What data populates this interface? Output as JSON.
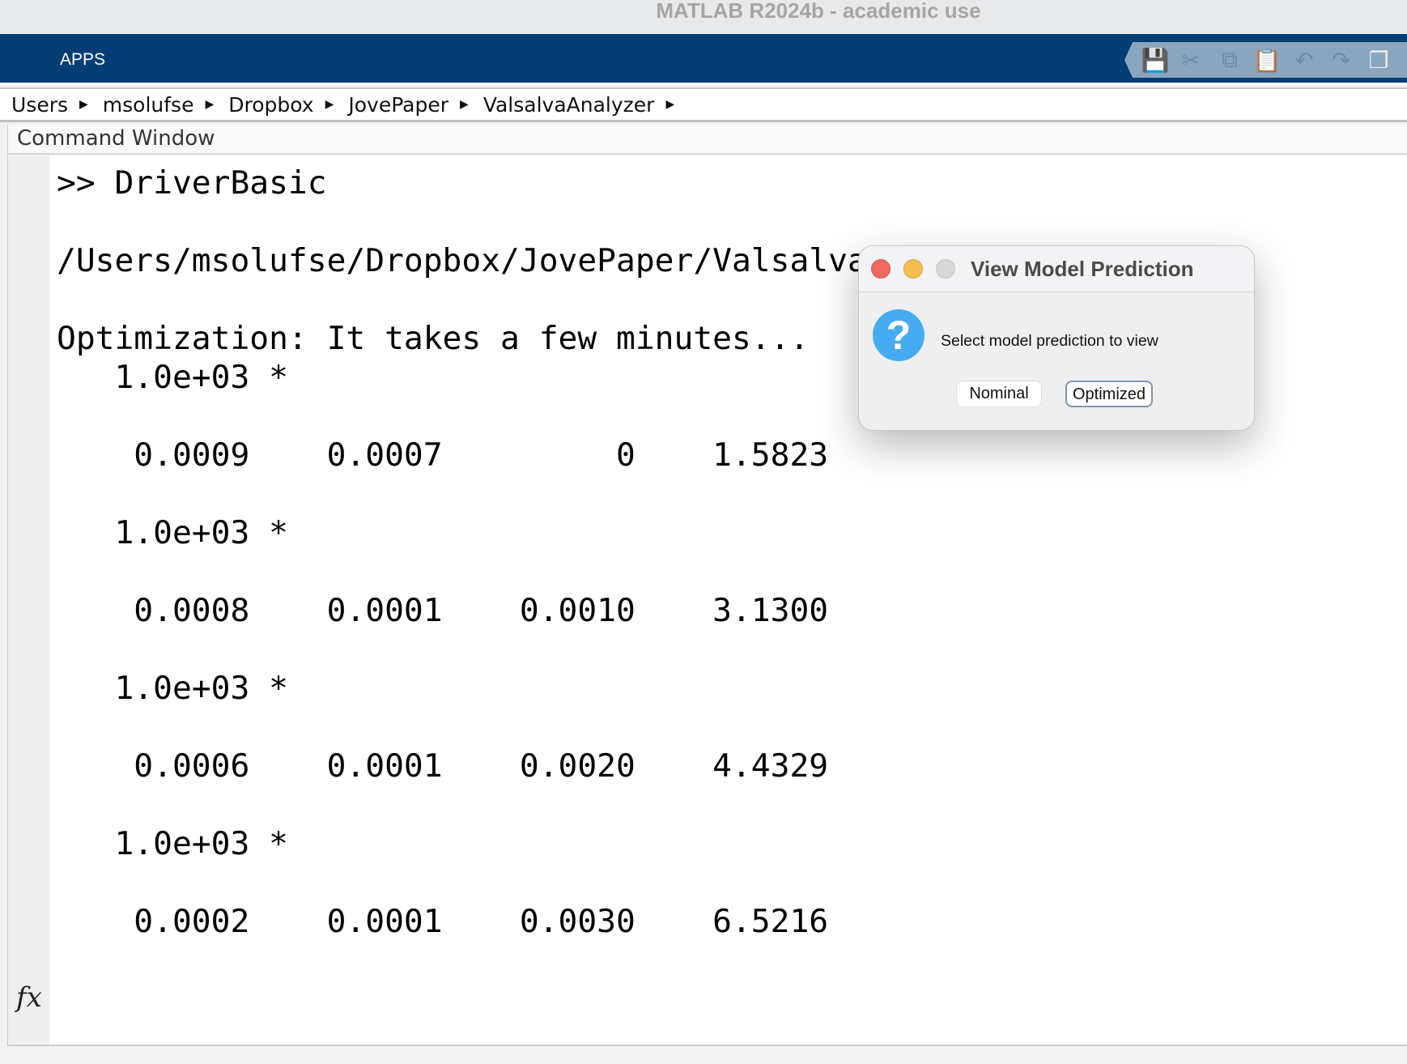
{
  "window": {
    "title": "MATLAB R2024b - academic use"
  },
  "ribbon": {
    "tab": "APPS",
    "quick_access": [
      "save-icon",
      "cut-icon",
      "copy-icon",
      "paste-icon",
      "undo-icon",
      "redo-icon",
      "window-layout-icon"
    ]
  },
  "breadcrumb": [
    "Users",
    "msolufse",
    "Dropbox",
    "JovePaper",
    "ValsalvaAnalyzer"
  ],
  "command_window": {
    "title": "Command Window",
    "lines": [
      ">> DriverBasic",
      "",
      "/Users/msolufse/Dropbox/JovePaper/Valsalva",
      "",
      "Optimization: It takes a few minutes...",
      "   1.0e+03 *",
      "",
      "    0.0009    0.0007         0    1.5823",
      "",
      "   1.0e+03 *",
      "",
      "    0.0008    0.0001    0.0010    3.1300",
      "",
      "   1.0e+03 *",
      "",
      "    0.0006    0.0001    0.0020    4.4329",
      "",
      "   1.0e+03 *",
      "",
      "    0.0002    0.0001    0.0030    6.5216"
    ],
    "prompt_icon": "fx"
  },
  "dialog": {
    "title": "View Model Prediction",
    "message": "Select model prediction to view",
    "buttons": [
      "Nominal",
      "Optimized"
    ],
    "colors": {
      "close": "#ee6a5f",
      "minimize": "#f5be4f",
      "zoom": "#d8d8d8",
      "question": "#45acf2"
    }
  }
}
